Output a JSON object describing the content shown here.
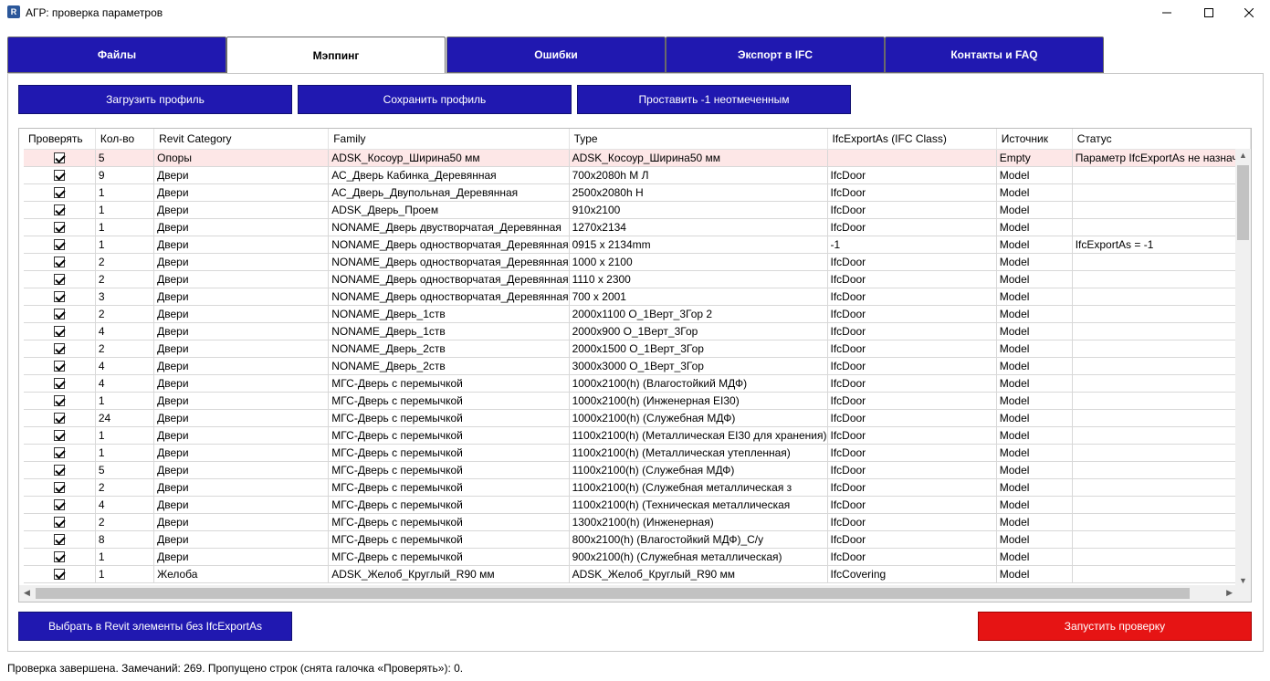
{
  "window": {
    "title": "АГР: проверка параметров",
    "icon": "R"
  },
  "tabs": [
    {
      "label": "Файлы",
      "active": false
    },
    {
      "label": "Мэппинг",
      "active": true
    },
    {
      "label": "Ошибки",
      "active": false
    },
    {
      "label": "Экспорт в IFC",
      "active": false
    },
    {
      "label": "Контакты и FAQ",
      "active": false
    }
  ],
  "toolbar": {
    "load_profile": "Загрузить профиль",
    "save_profile": "Сохранить профиль",
    "set_unchecked": "Проставить -1 неотмеченным"
  },
  "table": {
    "columns": [
      "Проверять",
      "Кол-во",
      "Revit Category",
      "Family",
      "Type",
      "IfcExportAs (IFC Class)",
      "Источник",
      "Статус"
    ],
    "rows": [
      {
        "checked": true,
        "error": true,
        "count": "5",
        "category": "Опоры",
        "family": "ADSK_Косоур_Ширина50 мм",
        "type": "ADSK_Косоур_Ширина50 мм",
        "ifc": "",
        "source": "Empty",
        "status": "Параметр IfcExportAs не назначен"
      },
      {
        "checked": true,
        "count": "9",
        "category": "Двери",
        "family": "АС_Дверь Кабинка_Деревянная",
        "type": "700x2080h М Л",
        "ifc": "IfcDoor",
        "source": "Model",
        "status": ""
      },
      {
        "checked": true,
        "count": "1",
        "category": "Двери",
        "family": "АС_Дверь_Двупольная_Деревянная",
        "type": "2500x2080h Н",
        "ifc": "IfcDoor",
        "source": "Model",
        "status": ""
      },
      {
        "checked": true,
        "count": "1",
        "category": "Двери",
        "family": "ADSK_Дверь_Проем",
        "type": "910x2100",
        "ifc": "IfcDoor",
        "source": "Model",
        "status": ""
      },
      {
        "checked": true,
        "count": "1",
        "category": "Двери",
        "family": "NONAME_Дверь двустворчатая_Деревянная",
        "type": "1270x2134",
        "ifc": "IfcDoor",
        "source": "Model",
        "status": ""
      },
      {
        "checked": true,
        "count": "1",
        "category": "Двери",
        "family": "NONAME_Дверь одностворчатая_Деревянная",
        "type": "0915 x 2134mm",
        "ifc": "-1",
        "source": "Model",
        "status": "IfcExportAs = -1"
      },
      {
        "checked": true,
        "count": "2",
        "category": "Двери",
        "family": "NONAME_Дверь одностворчатая_Деревянная",
        "type": "1000 x 2100",
        "ifc": "IfcDoor",
        "source": "Model",
        "status": ""
      },
      {
        "checked": true,
        "count": "2",
        "category": "Двери",
        "family": "NONAME_Дверь одностворчатая_Деревянная",
        "type": "1110 x 2300",
        "ifc": "IfcDoor",
        "source": "Model",
        "status": ""
      },
      {
        "checked": true,
        "count": "3",
        "category": "Двери",
        "family": "NONAME_Дверь одностворчатая_Деревянная",
        "type": "700 x 2001",
        "ifc": "IfcDoor",
        "source": "Model",
        "status": ""
      },
      {
        "checked": true,
        "count": "2",
        "category": "Двери",
        "family": "NONAME_Дверь_1ств",
        "type": "2000x1100 О_1Верт_3Гор 2",
        "ifc": "IfcDoor",
        "source": "Model",
        "status": ""
      },
      {
        "checked": true,
        "count": "4",
        "category": "Двери",
        "family": "NONAME_Дверь_1ств",
        "type": "2000x900 О_1Верт_3Гор",
        "ifc": "IfcDoor",
        "source": "Model",
        "status": ""
      },
      {
        "checked": true,
        "count": "2",
        "category": "Двери",
        "family": "NONAME_Дверь_2ств",
        "type": "2000x1500 О_1Верт_3Гор",
        "ifc": "IfcDoor",
        "source": "Model",
        "status": ""
      },
      {
        "checked": true,
        "count": "4",
        "category": "Двери",
        "family": "NONAME_Дверь_2ств",
        "type": "3000x3000 О_1Верт_3Гор",
        "ifc": "IfcDoor",
        "source": "Model",
        "status": ""
      },
      {
        "checked": true,
        "count": "4",
        "category": "Двери",
        "family": "МГС-Дверь с перемычкой",
        "type": "1000x2100(h) (Влагостойкий МДФ)",
        "ifc": "IfcDoor",
        "source": "Model",
        "status": ""
      },
      {
        "checked": true,
        "count": "1",
        "category": "Двери",
        "family": "МГС-Дверь с перемычкой",
        "type": "1000x2100(h) (Инженерная EI30)",
        "ifc": "IfcDoor",
        "source": "Model",
        "status": ""
      },
      {
        "checked": true,
        "count": "24",
        "category": "Двери",
        "family": "МГС-Дверь с перемычкой",
        "type": "1000x2100(h) (Служебная МДФ)",
        "ifc": "IfcDoor",
        "source": "Model",
        "status": ""
      },
      {
        "checked": true,
        "count": "1",
        "category": "Двери",
        "family": "МГС-Дверь с перемычкой",
        "type": "1100x2100(h) (Металлическая EI30 для хранения)",
        "ifc": "IfcDoor",
        "source": "Model",
        "status": ""
      },
      {
        "checked": true,
        "count": "1",
        "category": "Двери",
        "family": "МГС-Дверь с перемычкой",
        "type": "1100x2100(h) (Металлическая утепленная)",
        "ifc": "IfcDoor",
        "source": "Model",
        "status": ""
      },
      {
        "checked": true,
        "count": "5",
        "category": "Двери",
        "family": "МГС-Дверь с перемычкой",
        "type": "1100x2100(h) (Служебная МДФ)",
        "ifc": "IfcDoor",
        "source": "Model",
        "status": ""
      },
      {
        "checked": true,
        "count": "2",
        "category": "Двери",
        "family": "МГС-Дверь с перемычкой",
        "type": "1100x2100(h) (Служебная металлическая з",
        "ifc": "IfcDoor",
        "source": "Model",
        "status": ""
      },
      {
        "checked": true,
        "count": "4",
        "category": "Двери",
        "family": "МГС-Дверь с перемычкой",
        "type": "1100x2100(h) (Техническая металлическая",
        "ifc": "IfcDoor",
        "source": "Model",
        "status": ""
      },
      {
        "checked": true,
        "count": "2",
        "category": "Двери",
        "family": "МГС-Дверь с перемычкой",
        "type": "1300x2100(h) (Инженерная)",
        "ifc": "IfcDoor",
        "source": "Model",
        "status": ""
      },
      {
        "checked": true,
        "count": "8",
        "category": "Двери",
        "family": "МГС-Дверь с перемычкой",
        "type": "800x2100(h) (Влагостойкий МДФ)_С/у",
        "ifc": "IfcDoor",
        "source": "Model",
        "status": ""
      },
      {
        "checked": true,
        "count": "1",
        "category": "Двери",
        "family": "МГС-Дверь с перемычкой",
        "type": "900x2100(h) (Служебная металлическая)",
        "ifc": "IfcDoor",
        "source": "Model",
        "status": ""
      },
      {
        "checked": true,
        "count": "1",
        "category": "Желоба",
        "family": "ADSK_Желоб_Круглый_R90 мм",
        "type": "ADSK_Желоб_Круглый_R90 мм",
        "ifc": "IfcCovering",
        "source": "Model",
        "status": ""
      }
    ]
  },
  "actions": {
    "select_without": "Выбрать в Revit элементы без IfcExportAs",
    "run_check": "Запустить проверку"
  },
  "status_bar": "Проверка завершена. Замечаний: 269. Пропущено строк (снята галочка «Проверять»): 0.",
  "colors": {
    "accent": "#2018b0",
    "danger": "#e61414",
    "error_row": "#fde7e7"
  }
}
